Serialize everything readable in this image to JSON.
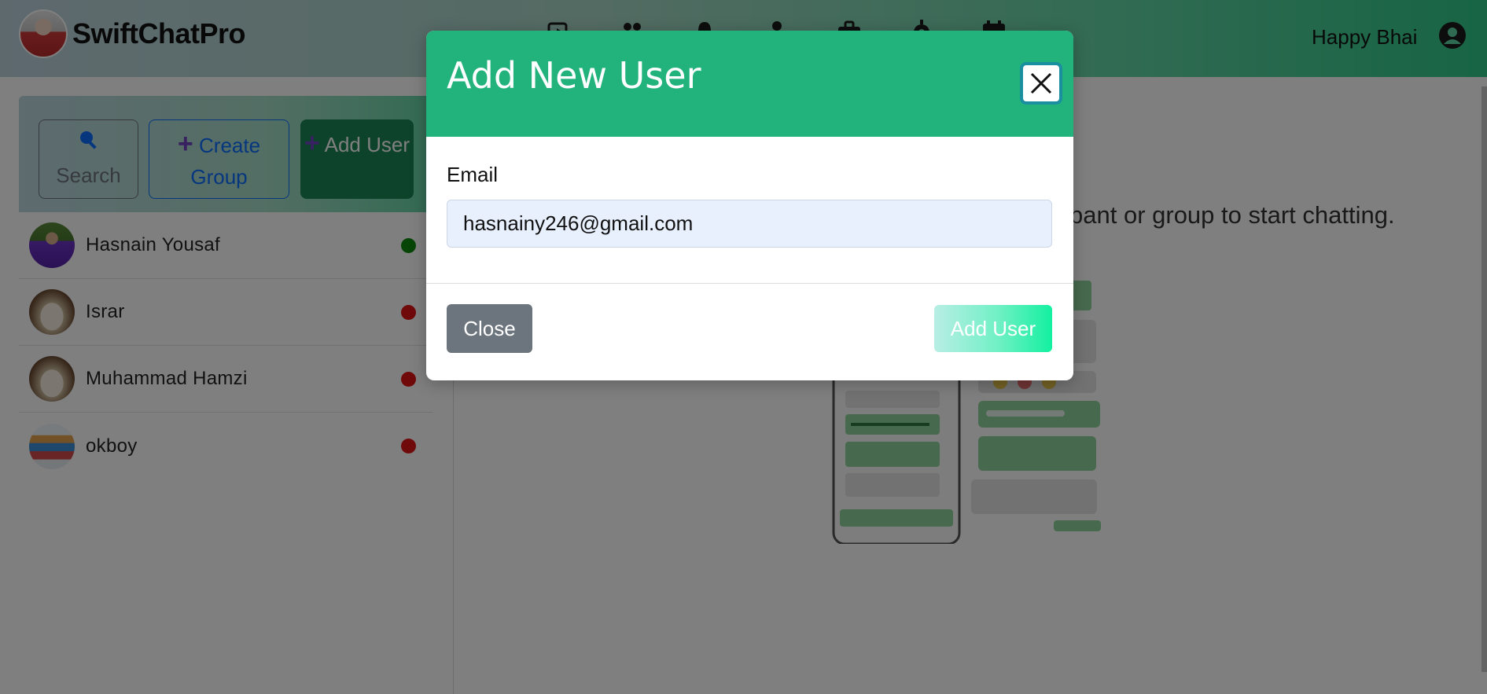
{
  "header": {
    "brand": "SwiftChatPro",
    "user_name": "Happy Bhai",
    "nav_icons": [
      "video-icon",
      "users-icon",
      "bell-icon",
      "person-icon",
      "briefcase-icon",
      "gear-icon",
      "calendar-icon"
    ]
  },
  "sidebar": {
    "search_label": "Search",
    "create_group_label": "Create Group",
    "add_user_label": "Add User",
    "users": [
      {
        "name": "Hasnain Yousaf",
        "status": "online"
      },
      {
        "name": "Israr",
        "status": "offline"
      },
      {
        "name": "Muhammad Hamzi",
        "status": "offline"
      },
      {
        "name": "okboy",
        "status": "offline"
      }
    ]
  },
  "main": {
    "hint": "pant or group to start chatting."
  },
  "modal": {
    "title": "Add New User",
    "email_label": "Email",
    "email_value": "hasnainy246@gmail.com",
    "close_label": "Close",
    "add_user_label": "Add User"
  },
  "colors": {
    "modal_header": "#22b27c",
    "online": "#0f8a0f",
    "offline": "#e01414",
    "add_user_button": "#198754",
    "create_group_accent": "#0d6efd"
  }
}
